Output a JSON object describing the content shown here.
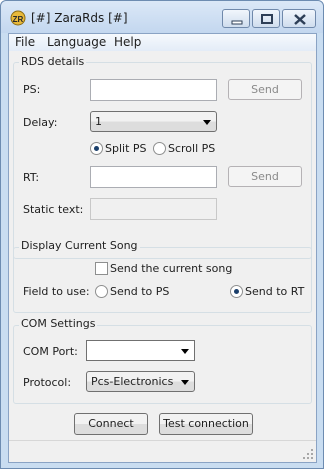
{
  "window": {
    "title": "[#] ZaraRds [#]",
    "icon": "zara-rds-app-icon",
    "controls": [
      "minimize-icon",
      "maximize-icon",
      "close-icon"
    ]
  },
  "menu": [
    "File",
    "Language",
    "Help"
  ],
  "rds": {
    "group_label": "RDS details",
    "ps_label": "PS:",
    "ps_value": "",
    "ps_send": "Send",
    "delay_label": "Delay:",
    "delay_value": "1",
    "split_ps": "Split PS",
    "scroll_ps": "Scroll PS",
    "ps_mode_selected": "Split PS",
    "rt_label": "RT:",
    "rt_value": "",
    "rt_send": "Send",
    "static_label": "Static text:",
    "static_value": ""
  },
  "song": {
    "group_label": "Display Current Song",
    "send_song": "Send the current song",
    "send_song_checked": false,
    "field_label": "Field to use:",
    "to_ps": "Send to PS",
    "to_rt": "Send to RT",
    "field_selected": "Send to RT"
  },
  "com": {
    "group_label": "COM Settings",
    "port_label": "COM Port:",
    "port_value": "",
    "protocol_label": "Protocol:",
    "protocol_value": "Pcs-Electronics"
  },
  "actions": {
    "connect": "Connect",
    "test": "Test connection"
  }
}
